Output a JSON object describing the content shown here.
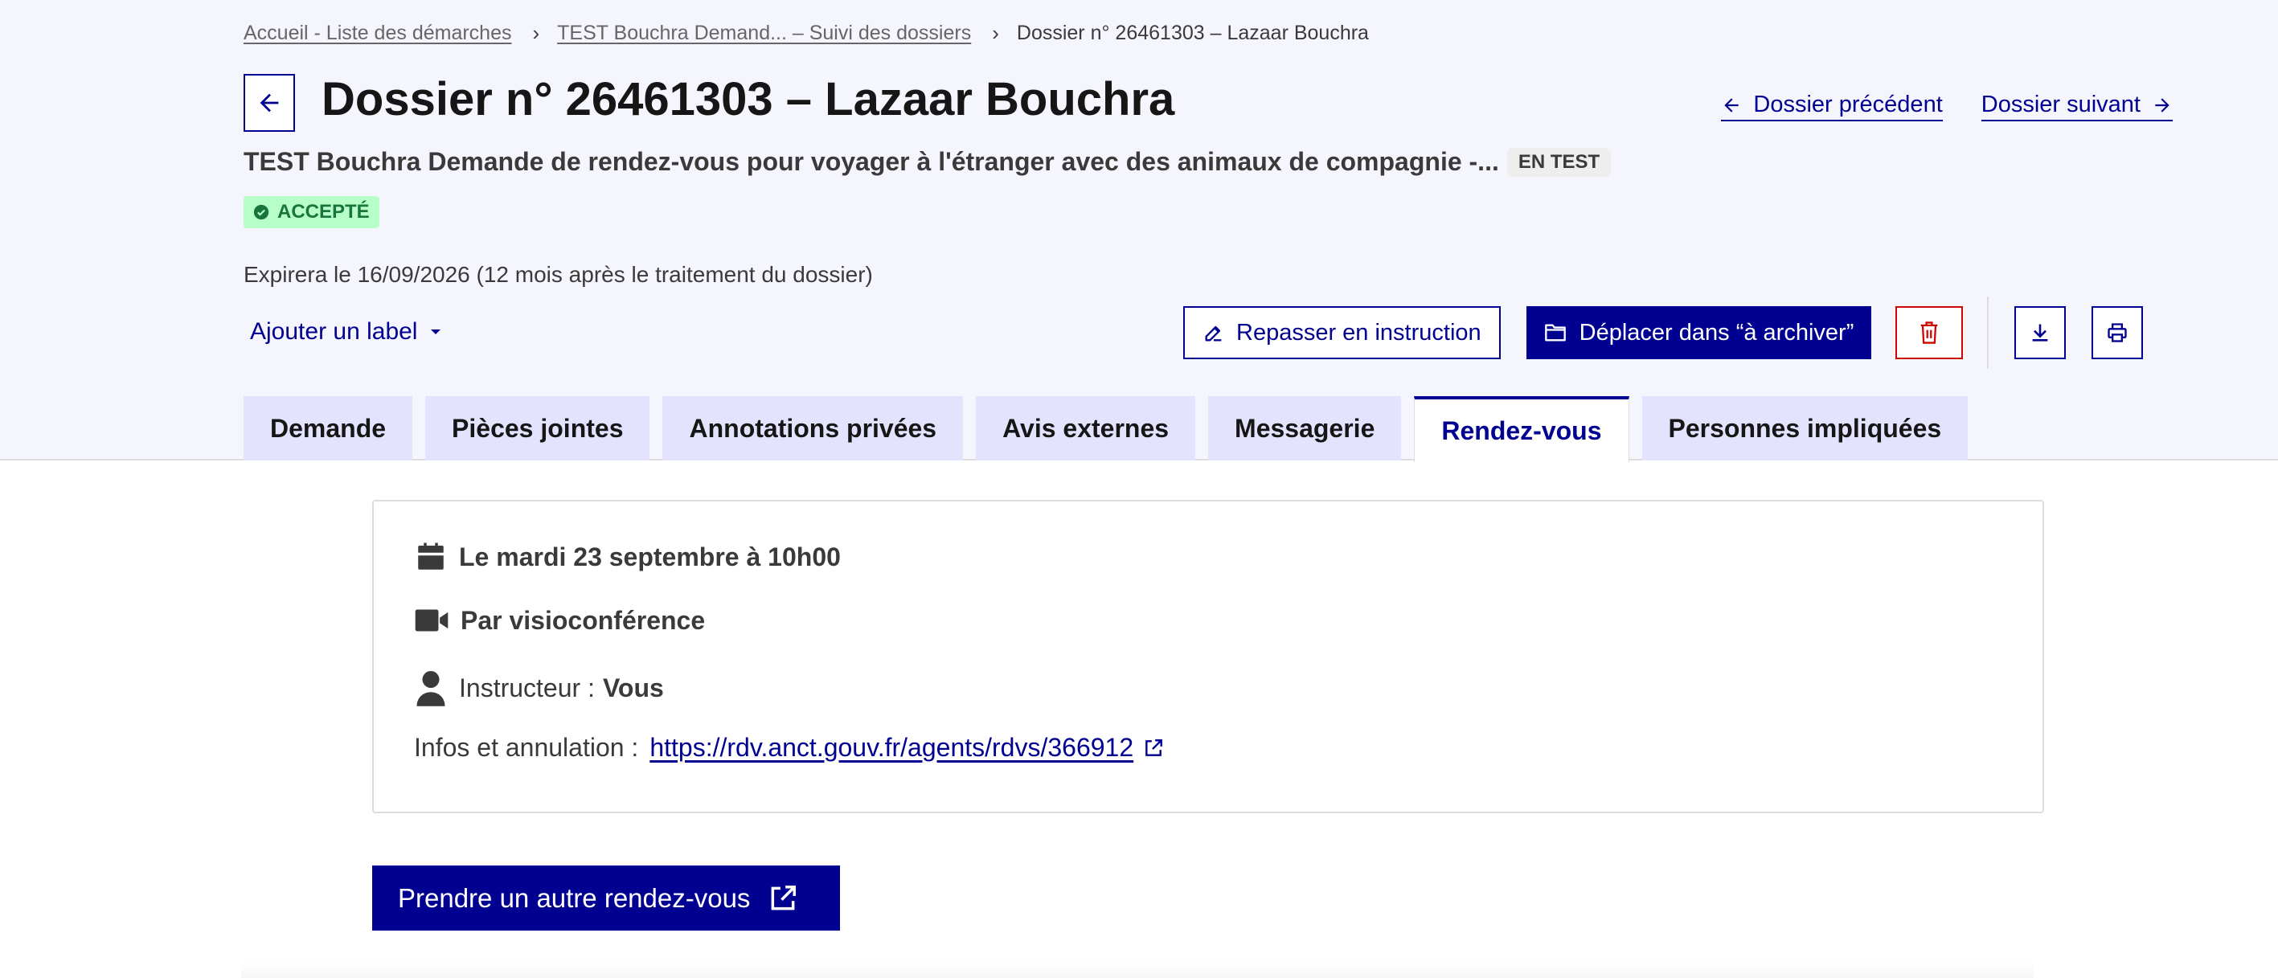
{
  "breadcrumb": {
    "home": "Accueil - Liste des démarches",
    "procedure": "TEST Bouchra Demand... – Suivi des dossiers",
    "current": "Dossier n° 26461303 – Lazaar Bouchra"
  },
  "header": {
    "title": "Dossier n° 26461303 – Lazaar Bouchra",
    "prev_label": "Dossier précédent",
    "next_label": "Dossier suivant",
    "procedure_title": "TEST Bouchra Demande de rendez-vous pour voyager à l'étranger avec des animaux de compagnie -...",
    "test_tag": "EN TEST",
    "status": "ACCEPTÉ",
    "expire": "Expirera le 16/09/2026 (12 mois après le traitement du dossier)"
  },
  "toolbar": {
    "add_label": "Ajouter un label",
    "reinstruct_label": "Repasser en instruction",
    "archive_label": "Déplacer dans “à archiver”"
  },
  "tabs": [
    {
      "label": "Demande"
    },
    {
      "label": "Pièces jointes"
    },
    {
      "label": "Annotations privées"
    },
    {
      "label": "Avis externes"
    },
    {
      "label": "Messagerie"
    },
    {
      "label": "Rendez-vous",
      "active": true
    },
    {
      "label": "Personnes impliquées"
    }
  ],
  "rdv": {
    "date": "Le mardi 23 septembre à 10h00",
    "mode": "Par visioconférence",
    "instructor_prefix": "Instructeur :",
    "instructor_name": "Vous",
    "info_prefix": "Infos et annulation :",
    "link": "https://rdv.anct.gouv.fr/agents/rdvs/366912"
  },
  "primary_action": {
    "label": "Prendre un autre rendez-vous"
  },
  "colors": {
    "primary": "#000091",
    "header_bg": "#f5f5fe",
    "tab_bg": "#e3e3fd",
    "status_bg": "#b8fec9",
    "status_fg": "#18753c",
    "danger": "#ce0500"
  }
}
